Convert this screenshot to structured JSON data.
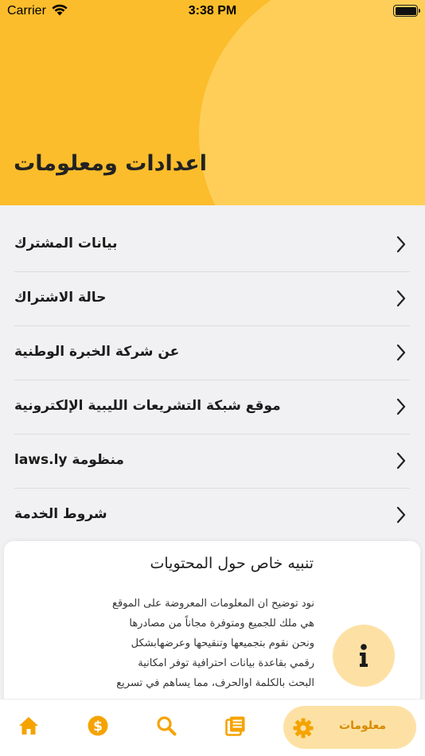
{
  "status_bar": {
    "carrier": "Carrier",
    "time": "3:38 PM",
    "battery_level": 1.0
  },
  "header": {
    "title": "اعدادات ومعلومات",
    "colors": {
      "primary": "#fbbd2c",
      "secondary": "#fece58"
    }
  },
  "menu": {
    "items": [
      {
        "label": "بيانات المشترك",
        "icon": "chevron-right-icon"
      },
      {
        "label": "حالة الاشتراك",
        "icon": "chevron-right-icon"
      },
      {
        "label": "عن شركة الخبرة الوطنية",
        "icon": "chevron-right-icon"
      },
      {
        "label": "موقع شبكة التشريعات الليبية الإلكترونية",
        "icon": "chevron-right-icon"
      },
      {
        "label": "منظومة laws.ly",
        "icon": "chevron-right-icon"
      },
      {
        "label": "شروط الخدمة",
        "icon": "chevron-right-icon"
      }
    ]
  },
  "notice": {
    "title": "تنبيه خاص حول المحتويات",
    "body": "نود توضيح ان المعلومات المعروضة على الموقع هي ملك للجميع ومتوفرة مجاناً من مصادرها ونحن نقوم بتجميعها وتنقيحها وعرضهابشكل رقمي بقاعدة بيانات احترافية توفر امكانية البحث بالكلمة اوالحرف، مما يساهم في تسريع",
    "icon": "info-icon"
  },
  "tabbar": {
    "accent": "#f5a300",
    "active_bg": "#fde1a4",
    "tabs": [
      {
        "icon": "home-icon"
      },
      {
        "icon": "dollar-icon"
      },
      {
        "icon": "search-icon"
      },
      {
        "icon": "newspaper-icon"
      },
      {
        "icon": "gear-icon",
        "label": "معلومات",
        "active": true
      }
    ]
  }
}
